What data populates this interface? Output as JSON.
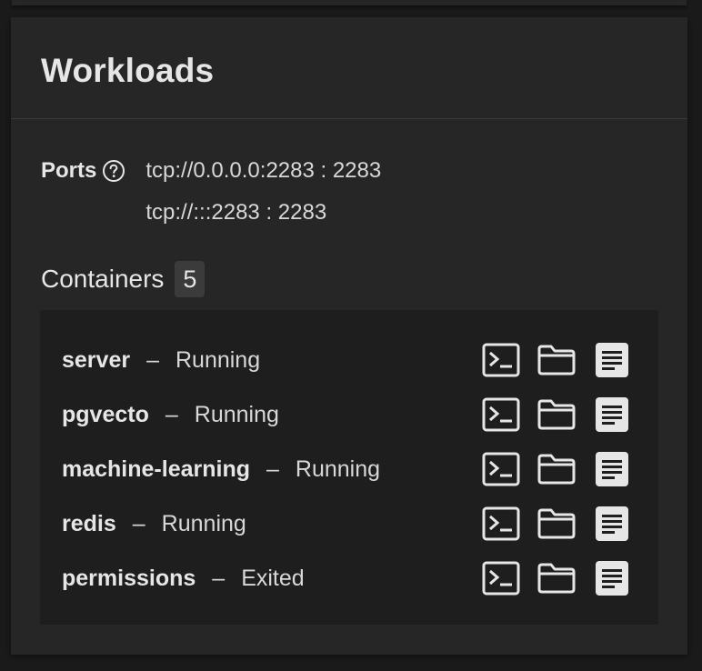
{
  "card": {
    "title": "Workloads"
  },
  "ports": {
    "label": "Ports",
    "help_icon": "help-circle-icon",
    "mappings": [
      "tcp://0.0.0.0:2283 : 2283",
      "tcp://:::2283 : 2283"
    ]
  },
  "containers": {
    "label": "Containers",
    "count": "5",
    "separator": "–",
    "items": [
      {
        "name": "server",
        "status": "Running"
      },
      {
        "name": "pgvecto",
        "status": "Running"
      },
      {
        "name": "machine-learning",
        "status": "Running"
      },
      {
        "name": "redis",
        "status": "Running"
      },
      {
        "name": "permissions",
        "status": "Exited"
      }
    ],
    "action_icons": [
      "terminal-icon",
      "folder-icon",
      "logs-icon"
    ]
  },
  "colors": {
    "background": "#1a1a1a",
    "card": "#262626",
    "panel": "#1e1e1e",
    "text": "#e6e6e6",
    "icon": "#e6e6e6"
  }
}
